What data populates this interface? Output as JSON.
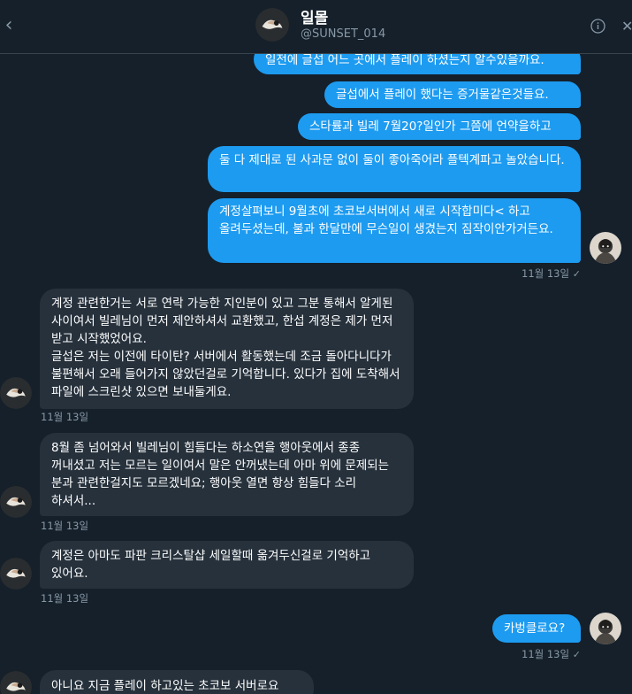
{
  "header": {
    "back_icon": "chevron-left-icon",
    "name": "일몰",
    "handle": "@SUNSET_014",
    "info_icon": "info-icon",
    "close_icon": "close-icon"
  },
  "messages": {
    "sent": [
      "일전에 글섭 어느 곳에서 플레이 하셨는지 알수있을까요.",
      "글섭에서 플레이 했다는 증거물같은것들요.",
      "스타률과 빌레 7월20?일인가 그쯤에 언약을하고",
      "둘 다 제대로 된 사과문 없이 둘이 좋아죽어라 플텍계파고 놀았습니다.",
      "계정살펴보니 9월초에 초코보서버에서 새로 시작합미다< 하고 올려두셨는데, 불과 한달만에 무슨일이 생겼는지 짐작이안가거든요.",
      "카벙클로요?"
    ],
    "received": [
      "계정 관련한거는 서로 연락 가능한 지인분이 있고 그분 통해서 알게된 사이여서 빌레님이 먼저 제안하셔서 교환했고, 한섭 계정은 제가 먼저 받고 시작했었어요.\n글섭은 저는 이전에 타이탄? 서버에서 활동했는데 조금 돌아다니다가 불편해서 오래 들어가지 않았던걸로 기억합니다. 있다가 집에 도착해서 파일에 스크린샷 있으면  보내둘게요.",
      "8월 좀 넘어와서 빌레님이 힘들다는 하소연을 행아웃에서 종종 꺼내셨고 저는 모르는 일이여서 말은 안꺼냈는데 아마 위에 문제되는 분과 관련한걸지도 모르겠네요; 행아웃 열면 항상 힘들다 소리 하셔서...",
      "계정은 아마도 파판 크리스탈샵 세일할때 옮겨두신걸로 기억하고 있어요.",
      "아니요 지금 플레이 하고있는 초코보 서버로요"
    ],
    "timestamps": {
      "sent_1": "11월 13일",
      "recv_1": "11월 13일",
      "recv_2": "11월 13일",
      "recv_3": "11월 13일",
      "sent_2": "11월 13일"
    },
    "read_mark": "✓"
  },
  "colors": {
    "background": "#15202b",
    "sent_bubble": "#1d9bf0",
    "received_bubble": "#26313c",
    "muted_text": "#8899a6"
  }
}
